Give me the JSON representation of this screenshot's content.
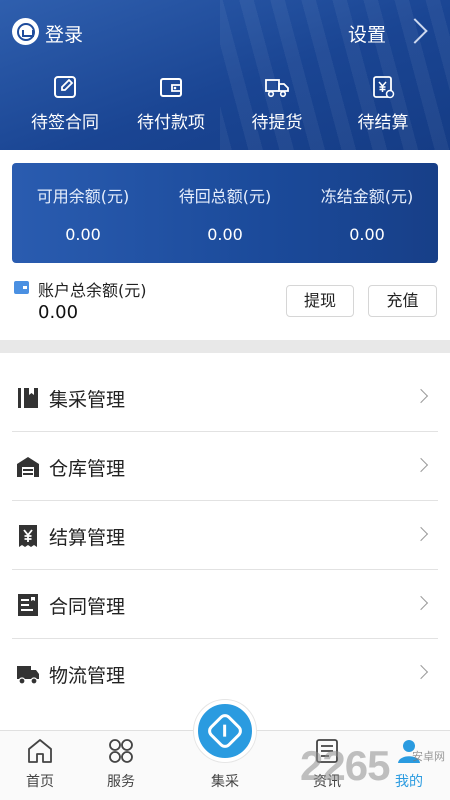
{
  "header": {
    "login_label": "登录",
    "settings_label": "设置",
    "quick_actions": [
      {
        "label": "待签合同",
        "icon": "edit-icon"
      },
      {
        "label": "待付款项",
        "icon": "wallet-icon"
      },
      {
        "label": "待提货",
        "icon": "truck-icon"
      },
      {
        "label": "待结算",
        "icon": "invoice-icon"
      }
    ]
  },
  "balance_card": {
    "items": [
      {
        "label": "可用余额(元)",
        "value": "0.00"
      },
      {
        "label": "待回总额(元)",
        "value": "0.00"
      },
      {
        "label": "冻结金额(元)",
        "value": "0.00"
      }
    ]
  },
  "account": {
    "total_label": "账户总余额(元)",
    "total_value": "0.00",
    "withdraw_label": "提现",
    "recharge_label": "充值"
  },
  "menu": [
    {
      "label": "集采管理",
      "icon": "book-icon"
    },
    {
      "label": "仓库管理",
      "icon": "warehouse-icon"
    },
    {
      "label": "结算管理",
      "icon": "yen-receipt-icon"
    },
    {
      "label": "合同管理",
      "icon": "contract-icon"
    },
    {
      "label": "物流管理",
      "icon": "truck-icon"
    }
  ],
  "tabbar": {
    "tabs": [
      {
        "label": "首页",
        "icon": "home-icon"
      },
      {
        "label": "服务",
        "icon": "grid-icon"
      },
      {
        "label": "集采",
        "icon": "center-logo-icon"
      },
      {
        "label": "资讯",
        "icon": "news-icon"
      },
      {
        "label": "我的",
        "icon": "user-icon"
      }
    ]
  },
  "watermark": {
    "number": "2265",
    "suffix": "安卓网"
  },
  "colors": {
    "header_blue": "#1a4593",
    "accent_blue": "#2a9be0",
    "divider": "#e8e8e8"
  }
}
